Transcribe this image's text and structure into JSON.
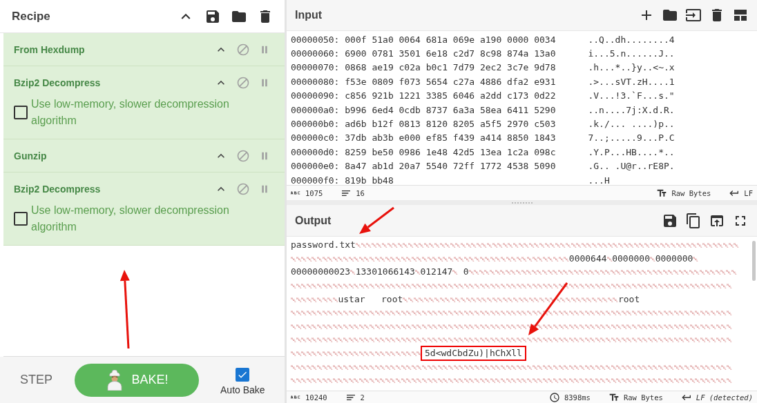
{
  "recipe": {
    "title": "Recipe",
    "operations": [
      {
        "name": "From Hexdump"
      },
      {
        "name": "Bzip2 Decompress",
        "options": [
          {
            "kind": "checkbox",
            "label": "Use low-memory, slower decompression algorithm",
            "checked": false
          }
        ]
      },
      {
        "name": "Gunzip"
      },
      {
        "name": "Bzip2 Decompress",
        "options": [
          {
            "kind": "checkbox",
            "label": "Use low-memory, slower decompression algorithm",
            "checked": false
          }
        ]
      }
    ]
  },
  "controls": {
    "step": "STEP",
    "bake": "BAKE!",
    "auto_bake": {
      "label": "Auto Bake",
      "checked": true
    }
  },
  "input": {
    "title": "Input",
    "lines": [
      {
        "address": "00000050:",
        "hex": "000f 51a0 0064 681a 069e a190 0000 0034",
        "ascii": "..Q..dh........4"
      },
      {
        "address": "00000060:",
        "hex": "6900 0781 3501 6e18 c2d7 8c98 874a 13a0",
        "ascii": "i...5.n......J.."
      },
      {
        "address": "00000070:",
        "hex": "0868 ae19 c02a b0c1 7d79 2ec2 3c7e 9d78",
        "ascii": ".h...*..}y..<~.x"
      },
      {
        "address": "00000080:",
        "hex": "f53e 0809 f073 5654 c27a 4886 dfa2 e931",
        "ascii": ".>...sVT.zH....1"
      },
      {
        "address": "00000090:",
        "hex": "c856 921b 1221 3385 6046 a2dd c173 0d22",
        "ascii": ".V...!3.`F...s.\""
      },
      {
        "address": "000000a0:",
        "hex": "b996 6ed4 0cdb 8737 6a3a 58ea 6411 5290",
        "ascii": "..n....7j:X.d.R."
      },
      {
        "address": "000000b0:",
        "hex": "ad6b b12f 0813 8120 8205 a5f5 2970 c503",
        "ascii": ".k./... ....)p.."
      },
      {
        "address": "000000c0:",
        "hex": "37db ab3b e000 ef85 f439 a414 8850 1843",
        "ascii": "7..;.....9...P.C"
      },
      {
        "address": "000000d0:",
        "hex": "8259 be50 0986 1e48 42d5 13ea 1c2a 098c",
        "ascii": ".Y.P...HB....*.."
      },
      {
        "address": "000000e0:",
        "hex": "8a47 ab1d 20a7 5540 72ff 1772 4538 5090",
        "ascii": ".G.. .U@r..rE8P."
      },
      {
        "address": "000000f0:",
        "hex": "819b bb48",
        "ascii": "...H"
      }
    ],
    "status": {
      "length": "1075",
      "lines": "16",
      "encoding": "Raw Bytes",
      "eol": "LF"
    }
  },
  "output": {
    "title": "Output",
    "lines": [
      {
        "segments": [
          {
            "kind": "text",
            "text": "password.txt"
          },
          {
            "kind": "null",
            "text": "␀␀␀␀␀␀␀␀␀␀␀␀␀␀␀␀␀␀␀␀␀␀␀␀␀␀␀␀␀␀␀␀␀␀␀␀␀␀␀␀␀␀␀␀␀␀␀␀␀␀␀␀␀␀␀␀␀␀␀␀␀␀␀␀␀␀␀␀␀␀␀␀␀"
          }
        ]
      },
      {
        "segments": [
          {
            "kind": "null",
            "text": "␀␀␀␀␀␀␀␀␀␀␀␀␀␀␀␀␀␀␀␀␀␀␀␀␀␀␀␀␀␀␀␀␀␀␀␀␀␀␀␀␀␀␀␀␀␀␀␀␀␀␀␀␀"
          },
          {
            "kind": "text",
            "text": "0000644"
          },
          {
            "kind": "null",
            "text": "␀"
          },
          {
            "kind": "text",
            "text": "0000000"
          },
          {
            "kind": "null",
            "text": "␀"
          },
          {
            "kind": "text",
            "text": "0000000"
          },
          {
            "kind": "null",
            "text": "␀"
          }
        ]
      },
      {
        "segments": [
          {
            "kind": "text",
            "text": "00000000023"
          },
          {
            "kind": "null",
            "text": "␀"
          },
          {
            "kind": "text",
            "text": "13301066143"
          },
          {
            "kind": "null",
            "text": "␀"
          },
          {
            "kind": "text",
            "text": "012147"
          },
          {
            "kind": "null",
            "text": "␀"
          },
          {
            "kind": "text",
            "text": " 0"
          },
          {
            "kind": "null",
            "text": "␀␀␀␀␀␀␀␀␀␀␀␀␀␀␀␀␀␀␀␀␀␀␀␀␀␀␀␀␀␀␀␀␀␀␀␀␀␀␀␀␀␀␀␀␀␀␀␀␀␀␀"
          }
        ]
      },
      {
        "segments": [
          {
            "kind": "null",
            "text": "␀␀␀␀␀␀␀␀␀␀␀␀␀␀␀␀␀␀␀␀␀␀␀␀␀␀␀␀␀␀␀␀␀␀␀␀␀␀␀␀␀␀␀␀␀␀␀␀␀␀␀␀␀␀␀␀␀␀␀␀␀␀␀␀␀␀␀␀␀␀␀␀␀␀␀␀␀␀␀␀␀␀␀␀"
          }
        ]
      },
      {
        "segments": [
          {
            "kind": "null",
            "text": "␀␀␀␀␀␀␀␀␀"
          },
          {
            "kind": "text",
            "text": "ustar   root"
          },
          {
            "kind": "null",
            "text": "␀␀␀␀␀␀␀␀␀␀␀␀␀␀␀␀␀␀␀␀␀␀␀␀␀␀␀␀␀␀␀␀␀␀␀␀␀␀␀␀␀"
          },
          {
            "kind": "text",
            "text": "root"
          }
        ]
      },
      {
        "segments": [
          {
            "kind": "null",
            "text": "␀␀␀␀␀␀␀␀␀␀␀␀␀␀␀␀␀␀␀␀␀␀␀␀␀␀␀␀␀␀␀␀␀␀␀␀␀␀␀␀␀␀␀␀␀␀␀␀␀␀␀␀␀␀␀␀␀␀␀␀␀␀␀␀␀␀␀␀␀␀␀␀␀␀␀␀␀␀␀␀␀␀␀␀"
          }
        ]
      },
      {
        "segments": [
          {
            "kind": "null",
            "text": "␀␀␀␀␀␀␀␀␀␀␀␀␀␀␀␀␀␀␀␀␀␀␀␀␀␀␀␀␀␀␀␀␀␀␀␀␀␀␀␀␀␀␀␀␀␀␀␀␀␀␀␀␀␀␀␀␀␀␀␀␀␀␀␀␀␀␀␀␀␀␀␀␀␀␀␀␀␀␀␀␀␀␀␀"
          }
        ]
      },
      {
        "segments": [
          {
            "kind": "null",
            "text": "␀␀␀␀␀␀␀␀␀␀␀␀␀␀␀␀␀␀␀␀␀␀␀␀␀␀␀␀␀␀␀␀␀␀␀␀␀␀␀␀␀␀␀␀␀␀␀␀␀␀␀␀␀␀␀␀␀␀␀␀␀␀␀␀␀␀␀␀␀␀␀␀␀␀␀␀␀␀␀␀␀␀␀␀"
          }
        ]
      },
      {
        "segments": [
          {
            "kind": "null",
            "text": "␀␀␀␀␀␀␀␀␀␀␀␀␀␀␀␀␀␀␀␀␀␀␀␀␀"
          },
          {
            "kind": "marked",
            "text": "5d<wdCbdZu)|hChXll"
          }
        ]
      },
      {
        "segments": [
          {
            "kind": "null",
            "text": "␀␀␀␀␀␀␀␀␀␀␀␀␀␀␀␀␀␀␀␀␀␀␀␀␀␀␀␀␀␀␀␀␀␀␀␀␀␀␀␀␀␀␀␀␀␀␀␀␀␀␀␀␀␀␀␀␀␀␀␀␀␀␀␀␀␀␀␀␀␀␀␀␀␀␀␀␀␀␀␀␀␀␀␀"
          }
        ]
      },
      {
        "segments": [
          {
            "kind": "null",
            "text": "␀␀␀␀␀␀␀␀␀␀␀␀␀␀␀␀␀␀␀␀␀␀␀␀␀␀␀␀␀␀␀␀␀␀␀␀␀␀␀␀␀␀␀␀␀␀␀␀␀␀␀␀␀␀␀␀␀␀␀␀␀␀␀␀␀␀␀␀␀␀␀␀␀␀␀␀␀␀␀␀␀␀␀␀"
          }
        ]
      }
    ],
    "status": {
      "length": "10240",
      "lines": "2",
      "time": "8398ms",
      "encoding": "Raw Bytes",
      "eol": "LF (detected)"
    }
  },
  "annotations": [
    {
      "kind": "arrow"
    },
    {
      "kind": "arrow"
    },
    {
      "kind": "arrow"
    }
  ]
}
